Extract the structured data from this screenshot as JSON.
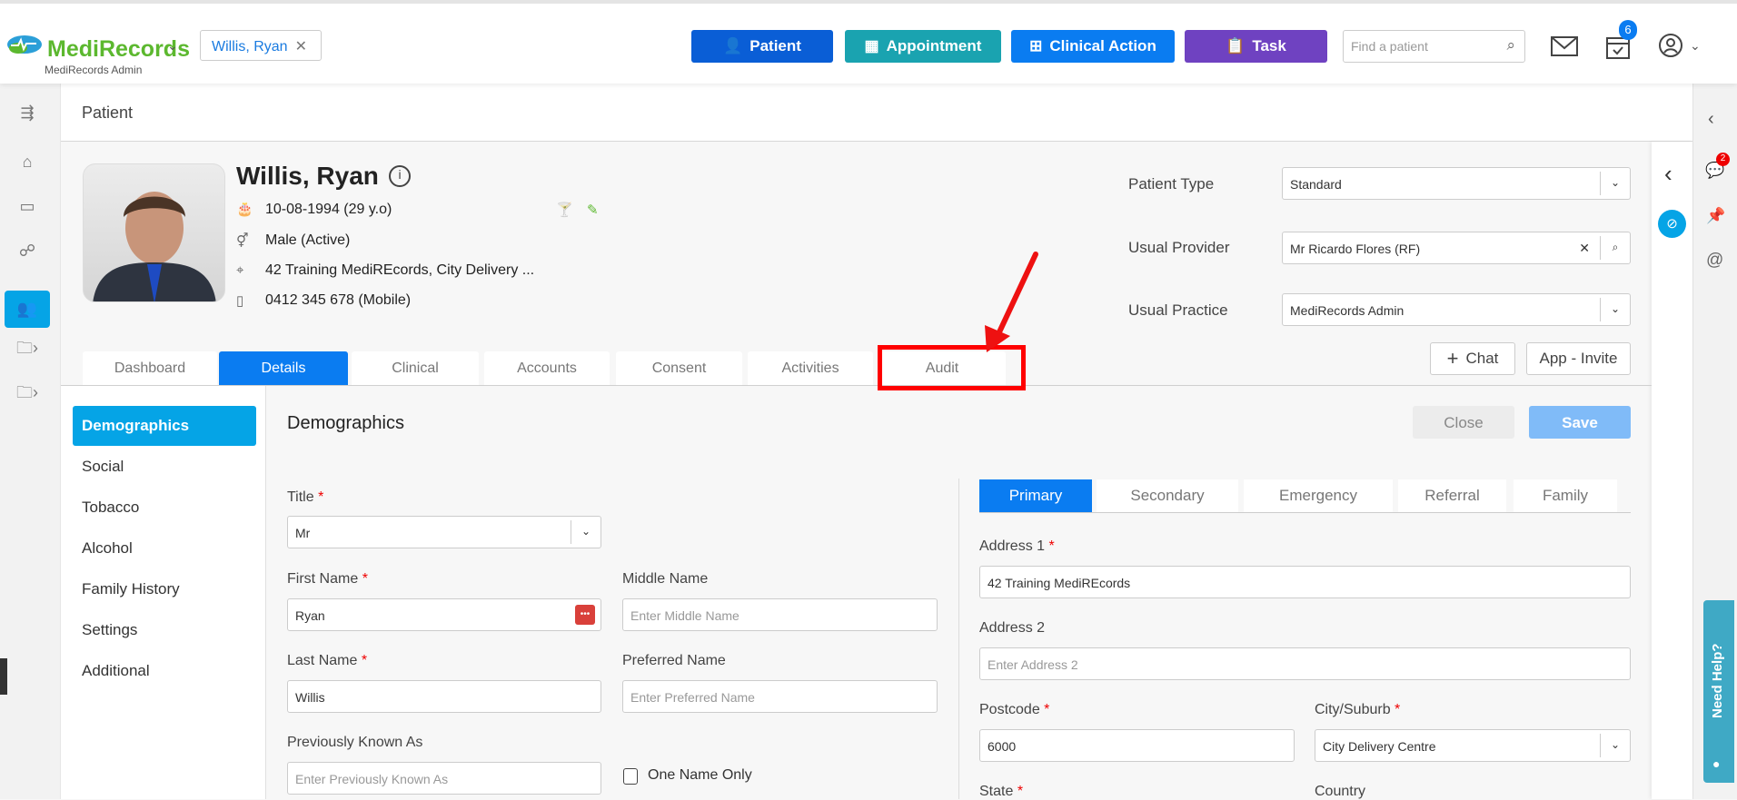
{
  "header": {
    "brand": "MediRecords",
    "org": "MediRecords Admin",
    "open_patient_tab": "Willis, Ryan",
    "buttons": {
      "patient": "Patient",
      "appointment": "Appointment",
      "clinical_action": "Clinical Action",
      "task": "Task"
    },
    "search_placeholder": "Find a patient",
    "calendar_badge": "6",
    "colors": {
      "patient": "#0a5ed6",
      "appointment": "#1aa3b0",
      "clinical_action": "#0a7cf1",
      "task": "#6f42c1"
    }
  },
  "page_title": "Patient",
  "patient": {
    "name": "Willis, Ryan",
    "dob": "10-08-1994 (29 y.o)",
    "gender": "Male (Active)",
    "address": "42 Training MediREcords, City Delivery ...",
    "phone": "0412 345 678 (Mobile)"
  },
  "fields": {
    "patient_type_label": "Patient Type",
    "patient_type": "Standard",
    "provider_label": "Usual Provider",
    "provider": "Mr Ricardo Flores (RF)",
    "practice_label": "Usual Practice",
    "practice": "MediRecords Admin"
  },
  "actions": {
    "chat": "Chat",
    "app_invite": "App - Invite"
  },
  "tabs": [
    "Dashboard",
    "Details",
    "Clinical",
    "Accounts",
    "Consent",
    "Activities",
    "Audit"
  ],
  "subnav": [
    "Demographics",
    "Social",
    "Tobacco",
    "Alcohol",
    "Family History",
    "Settings",
    "Additional"
  ],
  "section": {
    "title": "Demographics",
    "close": "Close",
    "save": "Save"
  },
  "form": {
    "title_label": "Title",
    "title_value": "Mr",
    "first_label": "First Name",
    "first_value": "Ryan",
    "middle_label": "Middle Name",
    "middle_ph": "Enter Middle Name",
    "last_label": "Last Name",
    "last_value": "Willis",
    "preferred_label": "Preferred Name",
    "preferred_ph": "Enter Preferred Name",
    "pka_label": "Previously Known As",
    "pka_ph": "Enter Previously Known As",
    "one_name": "One Name Only"
  },
  "address_tabs": [
    "Primary",
    "Secondary",
    "Emergency",
    "Referral",
    "Family"
  ],
  "address": {
    "a1_label": "Address 1",
    "a1_value": "42 Training MediREcords",
    "a2_label": "Address 2",
    "a2_ph": "Enter Address 2",
    "postcode_label": "Postcode",
    "postcode": "6000",
    "city_label": "City/Suburb",
    "city": "City Delivery Centre",
    "state_label": "State",
    "country_label": "Country"
  },
  "right_rail": {
    "chat_badge": "2"
  },
  "help": "Need Help?",
  "required_mark": "*"
}
